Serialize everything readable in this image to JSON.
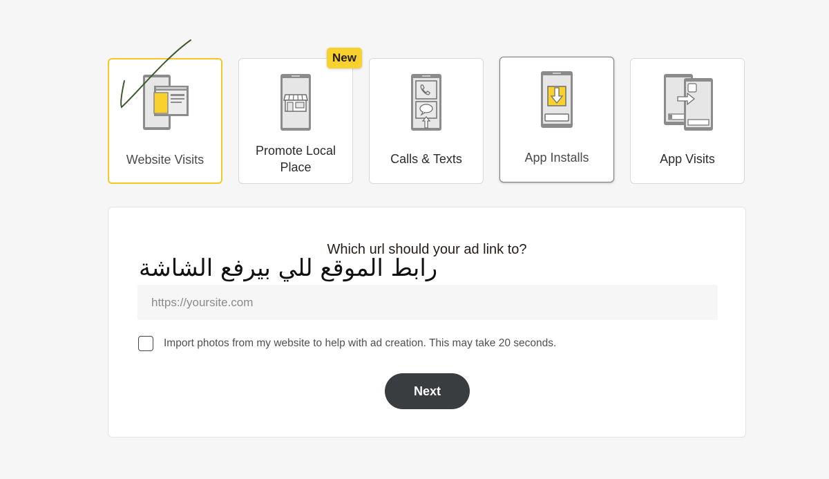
{
  "goals": [
    {
      "label": "Website Visits",
      "icon": "website-visits-icon",
      "selected": true
    },
    {
      "label": "Promote Local Place",
      "icon": "storefront-phone-icon",
      "badge": "New"
    },
    {
      "label": "Calls & Texts",
      "icon": "phone-calls-icon"
    },
    {
      "label": "App Installs",
      "icon": "app-download-icon",
      "hovered": true
    },
    {
      "label": "App Visits",
      "icon": "app-visits-icon"
    }
  ],
  "form": {
    "question": "Which url should your ad link to?",
    "annotation": "رابط الموقع للي بيرفع الشاشة",
    "url_placeholder": "https://yoursite.com",
    "url_value": "",
    "import_label": "Import photos from my website to help with ad creation. This may take 20 seconds.",
    "import_checked": false,
    "next_label": "Next"
  },
  "colors": {
    "accent": "#f8d12f",
    "selected_border": "#f2c824",
    "button_bg": "#3a3d40",
    "page_bg": "#f6f6f7",
    "checkmark": "#3c5a2a"
  }
}
